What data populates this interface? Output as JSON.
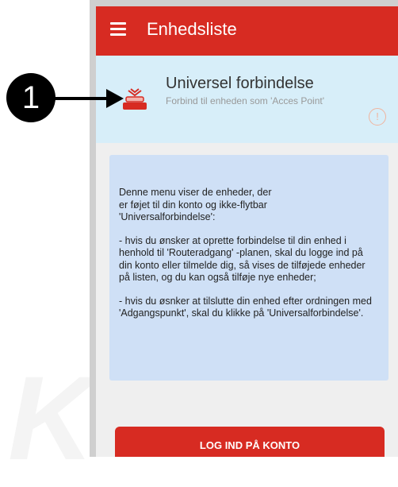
{
  "annotation": {
    "badge_number": "1"
  },
  "appbar": {
    "title": "Enhedsliste",
    "menu_icon": "hamburger-icon"
  },
  "universal": {
    "title": "Universel forbindelse",
    "subtitle": "Forbind til enheden som 'Acces Point'",
    "icon": "router-icon",
    "info_icon": "info-icon",
    "info_glyph": "!"
  },
  "infobox": {
    "paragraphs": [
      "Denne menu viser de enheder, der\ner føjet til din konto og ikke-flytbar\n'Universalforbindelse':",
      "  - hvis du ønsker at oprette forbindelse til din enhed i henhold til 'Routeradgang' -planen, skal du logge ind på din konto eller tilmelde dig, så vises de tilføjede enheder på listen, og du kan også tilføje nye enheder;",
      "  - hvis du øsnker at tilslutte din enhed efter ordningen med 'Adgangspunkt', skal du klikke på 'Universalforbindelse'."
    ]
  },
  "login_button": {
    "label": "LOG IND PÅ KONTO"
  },
  "colors": {
    "primary": "#d72b22",
    "info_bg": "#cfe0f6",
    "universal_bg": "#d7eef9"
  }
}
